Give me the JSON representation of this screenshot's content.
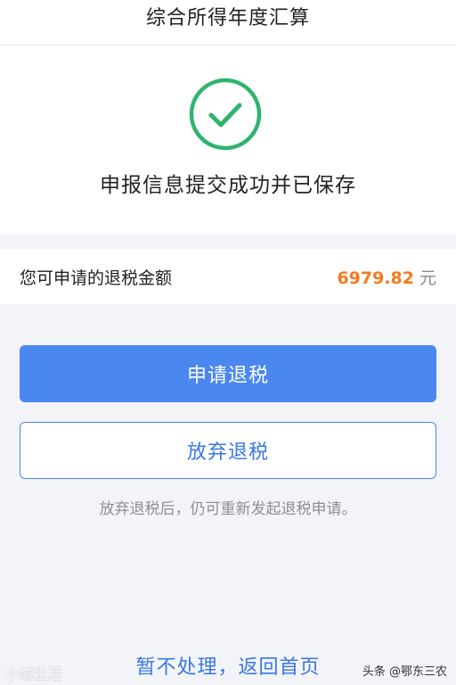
{
  "header": {
    "title": "综合所得年度汇算"
  },
  "success": {
    "icon": "check-circle-icon",
    "accent": "#2fb46e",
    "message": "申报信息提交成功并已保存"
  },
  "refund": {
    "label": "您可申请的退税金额",
    "amount": "6979.82",
    "unit": "元",
    "amount_color": "#f47a1f"
  },
  "actions": {
    "apply_label": "申请退税",
    "abandon_label": "放弃退税",
    "hint": "放弃退税后，仍可重新发起退税申请。",
    "later_label": "暂不处理，返回首页",
    "primary_color": "#4a87ef"
  },
  "watermarks": {
    "left": "小城生活",
    "right": "头条 @鄂东三农"
  }
}
